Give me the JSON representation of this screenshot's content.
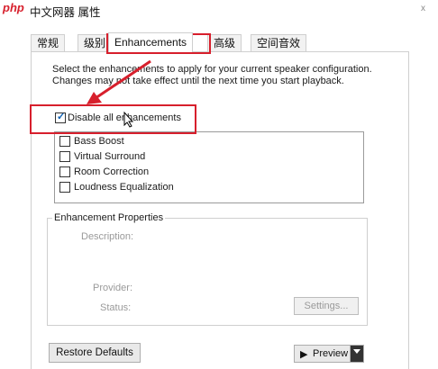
{
  "window": {
    "watermark": "php",
    "title": "中文网器 属性",
    "close_mark": "x"
  },
  "tabs": [
    {
      "label": "常规"
    },
    {
      "label": "级别"
    },
    {
      "label": "Enhancements"
    },
    {
      "label": "高级"
    },
    {
      "label": "空间音效"
    }
  ],
  "enhancements": {
    "description": "Select the enhancements to apply for your current speaker configuration. Changes may not take effect until the next time you start playback.",
    "disable_all": {
      "label": "Disable all enhancements",
      "checked": true
    },
    "items": [
      {
        "label": "Bass Boost",
        "checked": false
      },
      {
        "label": "Virtual Surround",
        "checked": false
      },
      {
        "label": "Room Correction",
        "checked": false
      },
      {
        "label": "Loudness Equalization",
        "checked": false
      }
    ]
  },
  "properties": {
    "group_title": "Enhancement Properties",
    "description_label": "Description:",
    "provider_label": "Provider:",
    "status_label": "Status:",
    "settings_button": "Settings..."
  },
  "footer": {
    "restore_defaults": "Restore Defaults",
    "preview": "Preview"
  },
  "colors": {
    "annotation_red": "#d71f2c",
    "check_blue": "#0b5fb3"
  },
  "icons": {
    "preview": "play-icon",
    "dropdown": "caret-down-icon"
  }
}
